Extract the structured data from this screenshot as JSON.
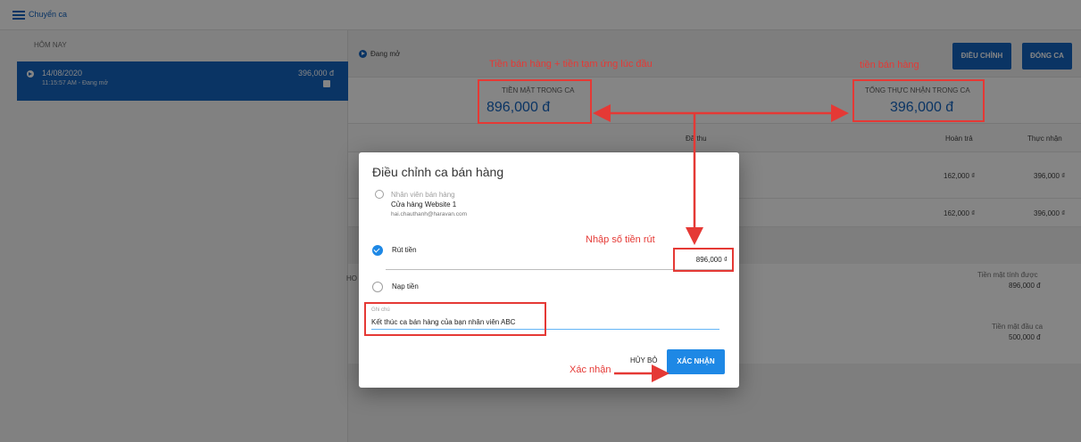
{
  "topbar": {
    "title": "Chuyển ca"
  },
  "sidebar": {
    "heading": "HÔM NAY",
    "shift": {
      "date": "14/08/2020",
      "time_status": "11:15:57 AM - Đang mở",
      "amount": "396,000 đ"
    }
  },
  "main": {
    "status": "Đang mở",
    "buttons": {
      "adjust": "ĐIỀU CHỈNH",
      "close": "ĐÓNG CA"
    },
    "stats": {
      "cash_label": "TIỀN MẶT TRONG CA",
      "cash_value": "896,000 đ",
      "received_label": "TỔNG THỰC NHẬN TRONG CA",
      "received_value": "396,000 đ"
    },
    "table": {
      "headers": [
        "Đã thu",
        "Hoàn trả",
        "Thực nhận"
      ],
      "rows": [
        {
          "refund": "162,000 ₫",
          "net": "396,000 ₫"
        },
        {
          "refund": "162,000 ₫",
          "net": "396,000 ₫"
        }
      ]
    },
    "summary": {
      "head": "HO",
      "cash_calc_label": "Tiền mặt tính được",
      "cash_calc_value": "896,000 đ",
      "opening_cash_label": "Tiền mặt đầu ca",
      "opening_cash_value": "500,000 đ"
    }
  },
  "modal": {
    "title": "Điều chỉnh ca bán hàng",
    "staff_label": "Nhân viên bán hàng",
    "staff_name": "Cửa hàng Website 1",
    "staff_email": "hai.chauthanh@haravan.com",
    "withdraw_label": "Rút tiền",
    "amount_value": "896,000 ₫",
    "deposit_label": "Nạp tiền",
    "note_label": "Ghi chú",
    "note_value": "Kết thúc ca bán hàng của bạn nhân viên ABC",
    "cancel_label": "HỦY BỎ",
    "confirm_label": "XÁC NHẬN"
  },
  "annotations": {
    "cash_note": "Tiền bán hàng + tiền tạm ứng lúc đầu",
    "sales_note": "tiền bán hàng",
    "amount_note": "Nhập số tiền rút",
    "confirm_note": "Xác nhận"
  },
  "colors": {
    "primary": "#1565c0",
    "accent": "#1e88e5",
    "annotation": "#e53935"
  }
}
